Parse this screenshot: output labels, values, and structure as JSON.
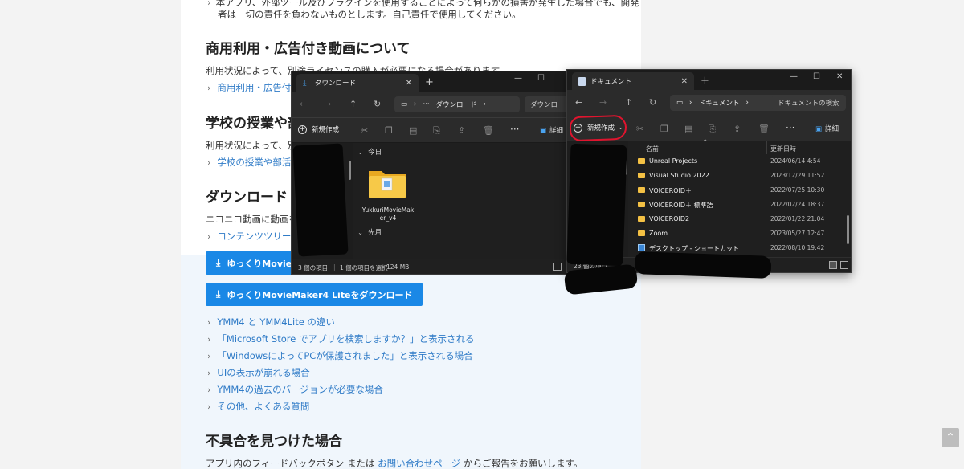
{
  "page": {
    "top_text_1": "本アプリ、外部ツール及びプラグインを使用することによって何らかの損害が発生した場合でも、開発",
    "top_text_2": "者は一切の責任を負わないものとします。自己責任で使用してください。",
    "section_commercial": {
      "heading": "商用利用・広告付き動画について",
      "text": "利用状況によって、別途ライセンスの購入が必要になる場合があります。",
      "link": "商用利用・広告付き"
    },
    "section_school": {
      "heading": "学校の授業や部",
      "text": "利用状況によって、別",
      "link": "学校の授業や部活動"
    },
    "section_download": {
      "heading": "ダウンロード",
      "text": "ニコニコ動画に動画を",
      "link": "コンテンツツリーの",
      "btn1": "ゆっくりMovieM",
      "btn2": "ゆっくりMovieMaker4 Liteをダウンロード"
    },
    "faq_links": [
      "YMM4 と YMM4Lite の違い",
      "「Microsoft Store でアプリを検索しますか？」と表示される",
      "「WindowsによってPCが保護されました」と表示される場合",
      "UIの表示が崩れる場合",
      "YMM4の過去のバージョンが必要な場合",
      "その他、よくある質問"
    ],
    "section_bug": {
      "heading": "不具合を見つけた場合",
      "text_before": "アプリ内のフィードバックボタン または ",
      "link": "お問い合わせページ",
      "text_after": " からご報告をお願いします。"
    }
  },
  "explorer_downloads": {
    "tab_title": "ダウンロード",
    "address": "ダウンロード",
    "search_placeholder": "ダウンロードの検",
    "new_button": "新規作成",
    "details_button": "詳細",
    "group_today": "今日",
    "group_month": "先月",
    "file_name": "YukkuriMovieMaker_v4",
    "status_items": "3 個の項目",
    "status_selected": "1 個の項目を選択",
    "status_size": "124 MB"
  },
  "explorer_documents": {
    "tab_title": "ドキュメント",
    "address": "ドキュメント",
    "search_placeholder": "ドキュメントの検索",
    "new_button": "新規作成",
    "details_button": "詳細",
    "col_name": "名前",
    "col_date": "更新日時",
    "rows": [
      {
        "name": "Unreal Projects",
        "date": "2024/06/14 4:54"
      },
      {
        "name": "Visual Studio 2022",
        "date": "2023/12/29 11:52"
      },
      {
        "name": "VOICEROID＋",
        "date": "2022/07/25 10:30"
      },
      {
        "name": "VOICEROID＋ 標準語",
        "date": "2022/02/24 18:37"
      },
      {
        "name": "VOICEROID2",
        "date": "2022/01/22 21:04"
      },
      {
        "name": "Zoom",
        "date": "2023/05/27 12:47"
      },
      {
        "name": "デスクトップ - ショートカット",
        "date": "2022/08/10 19:42"
      }
    ],
    "status_items": "23 個の項目"
  },
  "colors": {
    "link": "#2f7bc7",
    "button": "#1a88e6",
    "highlight_circle": "#e0142e",
    "folder": "#f4c144",
    "explorer_bg": "#202020"
  }
}
